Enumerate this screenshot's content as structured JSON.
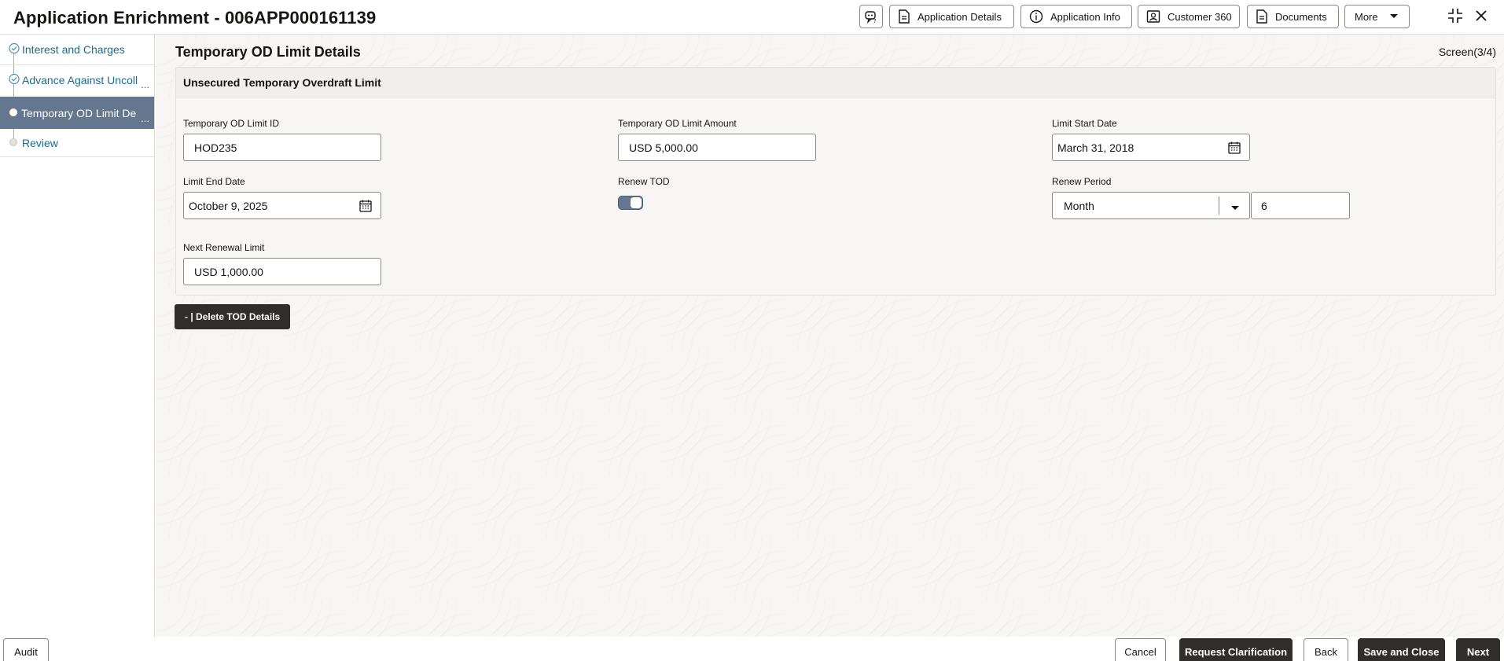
{
  "header": {
    "title": "Application Enrichment - 006APP000161139",
    "buttons": {
      "application_details": "Application Details",
      "application_info": "Application Info",
      "customer_360": "Customer 360",
      "documents": "Documents",
      "more": "More"
    },
    "icons": [
      "assistant-icon",
      "document-icon",
      "info-icon",
      "contact-card-icon",
      "documents-icon",
      "caret-down-icon",
      "collapse-icon",
      "close-icon"
    ]
  },
  "sidebar": {
    "steps": [
      {
        "label": "Interest and Charges",
        "state": "done"
      },
      {
        "label": "Advance Against Uncoll",
        "state": "done",
        "ellipsis": "..."
      },
      {
        "label": "Temporary OD Limit De",
        "state": "active",
        "ellipsis": "..."
      },
      {
        "label": "Review",
        "state": "pending"
      }
    ]
  },
  "main": {
    "page_title": "Temporary OD Limit Details",
    "screen_count": "Screen(3/4)",
    "section_title": "Unsecured Temporary Overdraft Limit",
    "fields": {
      "limit_id": {
        "label": "Temporary OD Limit ID",
        "value": "HOD235"
      },
      "limit_amount": {
        "label": "Temporary OD Limit Amount",
        "value": "USD 5,000.00"
      },
      "start_date": {
        "label": "Limit Start Date",
        "value": "March 31, 2018"
      },
      "end_date": {
        "label": "Limit End Date",
        "value": "October 9, 2025"
      },
      "renew_tod": {
        "label": "Renew TOD",
        "checked": true
      },
      "renew_period": {
        "label": "Renew Period",
        "unit": "Month",
        "count": "6"
      },
      "next_renewal_limit": {
        "label": "Next Renewal Limit",
        "value": "USD 1,000.00"
      }
    },
    "delete_button": "- | Delete TOD Details"
  },
  "footer": {
    "audit": "Audit",
    "cancel": "Cancel",
    "request_clarification": "Request Clarification",
    "back": "Back",
    "save_and_close": "Save and Close",
    "next": "Next"
  },
  "colors": {
    "active_step": "#65768f",
    "link": "#1c6c8c",
    "dark_button": "#312d2a"
  }
}
